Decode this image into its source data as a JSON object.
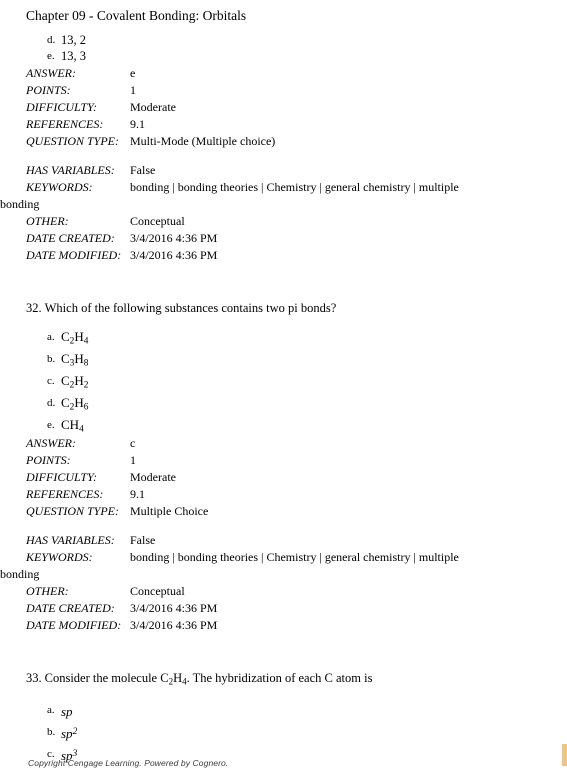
{
  "header": {
    "title": "Chapter 09 - Covalent Bonding: Orbitals"
  },
  "footer": {
    "copyright": "Copyright Cengage Learning. Powered by Cognero."
  },
  "prev_question_tail": {
    "choices": [
      {
        "letter": "d.",
        "text": "13, 2"
      },
      {
        "letter": "e.",
        "text": "13, 3"
      }
    ],
    "meta": {
      "answer_label": "ANSWER:",
      "answer_value": "e",
      "points_label": "POINTS:",
      "points_value": "1",
      "difficulty_label": "DIFFICULTY:",
      "difficulty_value": "Moderate",
      "references_label": "REFERENCES:",
      "references_value": "9.1",
      "question_type_label": "QUESTION TYPE:",
      "question_type_value": "Multi-Mode (Multiple choice)",
      "has_variables_label": "HAS VARIABLES:",
      "has_variables_value": "False",
      "keywords_label": "KEYWORDS:",
      "keywords_value": "bonding | bonding theories | Chemistry | general chemistry | multiple bonding",
      "other_label": "OTHER:",
      "other_value": "Conceptual",
      "date_created_label": "DATE CREATED:",
      "date_created_value": "3/4/2016 4:36 PM",
      "date_modified_label": "DATE MODIFIED:",
      "date_modified_value": "3/4/2016 4:36 PM"
    }
  },
  "question_32": {
    "number": "32.",
    "stem": "Which of the following substances contains two pi bonds?",
    "choices": [
      {
        "letter": "a.",
        "formula": [
          {
            "t": "C"
          },
          {
            "t": "2",
            "sub": true
          },
          {
            "t": "H"
          },
          {
            "t": "4",
            "sub": true
          }
        ]
      },
      {
        "letter": "b.",
        "formula": [
          {
            "t": "C"
          },
          {
            "t": "3",
            "sub": true
          },
          {
            "t": "H"
          },
          {
            "t": "8",
            "sub": true
          }
        ]
      },
      {
        "letter": "c.",
        "formula": [
          {
            "t": "C"
          },
          {
            "t": "2",
            "sub": true
          },
          {
            "t": "H"
          },
          {
            "t": "2",
            "sub": true
          }
        ]
      },
      {
        "letter": "d.",
        "formula": [
          {
            "t": "C"
          },
          {
            "t": "2",
            "sub": true
          },
          {
            "t": "H"
          },
          {
            "t": "6",
            "sub": true
          }
        ]
      },
      {
        "letter": "e.",
        "formula": [
          {
            "t": "CH"
          },
          {
            "t": "4",
            "sub": true
          }
        ]
      }
    ],
    "meta": {
      "answer_label": "ANSWER:",
      "answer_value": "c",
      "points_label": "POINTS:",
      "points_value": "1",
      "difficulty_label": "DIFFICULTY:",
      "difficulty_value": "Moderate",
      "references_label": "REFERENCES:",
      "references_value": "9.1",
      "question_type_label": "QUESTION TYPE:",
      "question_type_value": "Multiple Choice",
      "has_variables_label": "HAS VARIABLES:",
      "has_variables_value": "False",
      "keywords_label": "KEYWORDS:",
      "keywords_value": "bonding | bonding theories | Chemistry | general chemistry | multiple bonding",
      "other_label": "OTHER:",
      "other_value": "Conceptual",
      "date_created_label": "DATE CREATED:",
      "date_created_value": "3/4/2016 4:36 PM",
      "date_modified_label": "DATE MODIFIED:",
      "date_modified_value": "3/4/2016 4:36 PM"
    }
  },
  "question_33": {
    "number": "33.",
    "stem_part1": "Consider the molecule C",
    "stem_sub1": "2",
    "stem_part2": "H",
    "stem_sub2": "4",
    "stem_part3": ". The hybridization of each C atom is",
    "choices": [
      {
        "letter": "a.",
        "base": "sp",
        "exp": ""
      },
      {
        "letter": "b.",
        "base": "sp",
        "exp": "2"
      },
      {
        "letter": "c.",
        "base": "sp",
        "exp": "3"
      }
    ]
  }
}
